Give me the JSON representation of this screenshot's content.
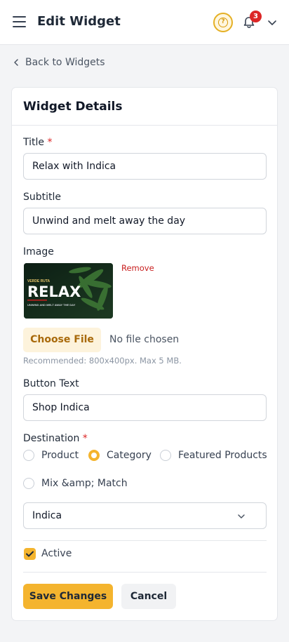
{
  "header": {
    "title": "Edit Widget",
    "help_icon": "question-circle-icon",
    "notification_count": "3",
    "accent": "#f4b42e"
  },
  "back_link": "Back to Widgets",
  "card": {
    "title": "Widget Details",
    "title_field": {
      "label": "Title",
      "required_mark": "*",
      "value": "Relax with Indica"
    },
    "subtitle_field": {
      "label": "Subtitle",
      "value": "Unwind and melt away the day"
    },
    "image": {
      "label": "Image",
      "remove_label": "Remove",
      "thumb_brand": "VERDE RUTA",
      "thumb_headline": "RELAX",
      "thumb_tagline": "UNWIND AND MELT AWAY THE DAY",
      "choose_label": "Choose File",
      "file_status": "No file chosen",
      "hint": "Recommended: 800x400px. Max 5 MB."
    },
    "button_text_field": {
      "label": "Button Text",
      "value": "Shop Indica"
    },
    "destination": {
      "label": "Destination",
      "required_mark": "*",
      "options": [
        {
          "label": "Product",
          "selected": false
        },
        {
          "label": "Category",
          "selected": true
        },
        {
          "label": "Featured Products",
          "selected": false
        },
        {
          "label": "Mix &amp; Match",
          "selected": false
        }
      ],
      "selected_value": "Indica"
    },
    "active": {
      "label": "Active",
      "checked": true
    },
    "save_label": "Save Changes",
    "cancel_label": "Cancel"
  }
}
